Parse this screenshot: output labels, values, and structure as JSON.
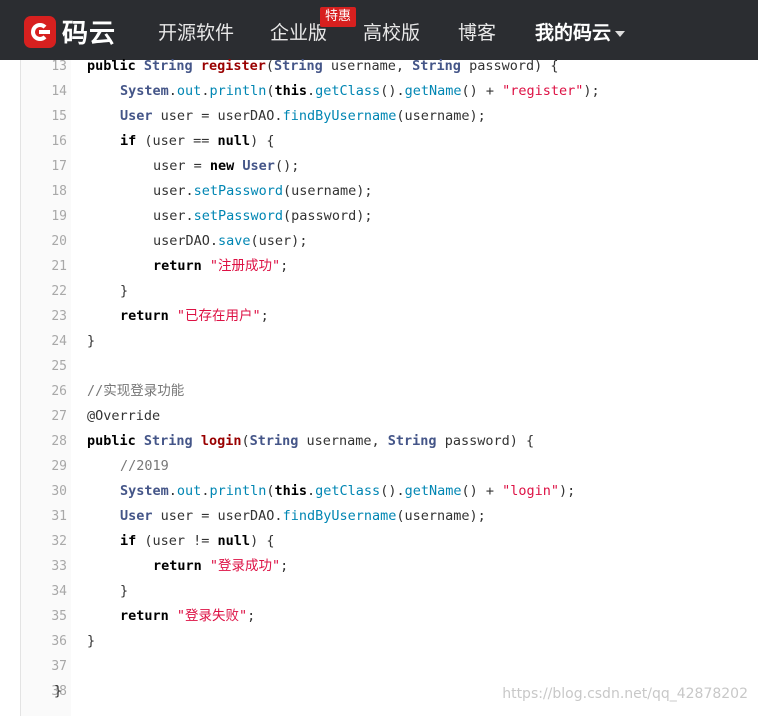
{
  "header": {
    "logo_text": "码云",
    "nav": [
      "开源软件",
      "企业版",
      "高校版",
      "博客"
    ],
    "badge": "特惠",
    "my_menu": "我的码云"
  },
  "code_lines": [
    {
      "n": "13",
      "i": 1,
      "t": [
        [
          "kw",
          "public "
        ],
        [
          "tp",
          "String "
        ],
        [
          "fn",
          "register"
        ],
        [
          "",
          "("
        ],
        [
          "tp",
          "String"
        ],
        [
          "",
          " username, "
        ],
        [
          "tp",
          "String"
        ],
        [
          "",
          " password) {"
        ]
      ]
    },
    {
      "n": "14",
      "i": 2,
      "t": [
        [
          "tp",
          "System"
        ],
        [
          "",
          "."
        ],
        [
          "mt",
          "out"
        ],
        [
          "",
          "."
        ],
        [
          "mt",
          "println"
        ],
        [
          "",
          "("
        ],
        [
          "kw",
          "this"
        ],
        [
          "",
          "."
        ],
        [
          "mt",
          "getClass"
        ],
        [
          "",
          "()."
        ],
        [
          "mt",
          "getName"
        ],
        [
          "",
          "() + "
        ],
        [
          "st",
          "\"register\""
        ],
        [
          "",
          ");"
        ]
      ]
    },
    {
      "n": "15",
      "i": 2,
      "t": [
        [
          "tp",
          "User"
        ],
        [
          "",
          " user = userDAO."
        ],
        [
          "mt",
          "findByUsername"
        ],
        [
          "",
          "(username);"
        ]
      ]
    },
    {
      "n": "16",
      "i": 2,
      "t": [
        [
          "kw",
          "if"
        ],
        [
          "",
          " (user == "
        ],
        [
          "kw",
          "null"
        ],
        [
          "",
          ") {"
        ]
      ]
    },
    {
      "n": "17",
      "i": 3,
      "t": [
        [
          "",
          "user = "
        ],
        [
          "kw",
          "new "
        ],
        [
          "tp",
          "User"
        ],
        [
          "",
          "();"
        ]
      ]
    },
    {
      "n": "18",
      "i": 3,
      "t": [
        [
          "",
          "user."
        ],
        [
          "mt",
          "setPassword"
        ],
        [
          "",
          "(username);"
        ]
      ]
    },
    {
      "n": "19",
      "i": 3,
      "t": [
        [
          "",
          "user."
        ],
        [
          "mt",
          "setPassword"
        ],
        [
          "",
          "(password);"
        ]
      ]
    },
    {
      "n": "20",
      "i": 3,
      "t": [
        [
          "",
          "userDAO."
        ],
        [
          "mt",
          "save"
        ],
        [
          "",
          "(user);"
        ]
      ]
    },
    {
      "n": "21",
      "i": 3,
      "t": [
        [
          "kw",
          "return "
        ],
        [
          "st",
          "\"注册成功\""
        ],
        [
          "",
          ";"
        ]
      ]
    },
    {
      "n": "22",
      "i": 2,
      "t": [
        [
          "",
          "}"
        ]
      ]
    },
    {
      "n": "23",
      "i": 2,
      "t": [
        [
          "kw",
          "return "
        ],
        [
          "st",
          "\"已存在用户\""
        ],
        [
          "",
          ";"
        ]
      ]
    },
    {
      "n": "24",
      "i": 1,
      "t": [
        [
          "",
          "}"
        ]
      ]
    },
    {
      "n": "25",
      "i": 0,
      "t": []
    },
    {
      "n": "26",
      "i": 1,
      "t": [
        [
          "cm",
          "//实现登录功能"
        ]
      ]
    },
    {
      "n": "27",
      "i": 1,
      "t": [
        [
          "",
          "@Override"
        ]
      ]
    },
    {
      "n": "28",
      "i": 1,
      "t": [
        [
          "kw",
          "public "
        ],
        [
          "tp",
          "String "
        ],
        [
          "fn",
          "login"
        ],
        [
          "",
          "("
        ],
        [
          "tp",
          "String"
        ],
        [
          "",
          " username, "
        ],
        [
          "tp",
          "String"
        ],
        [
          "",
          " password) {"
        ]
      ]
    },
    {
      "n": "29",
      "i": 2,
      "t": [
        [
          "cm",
          "//2019"
        ]
      ]
    },
    {
      "n": "30",
      "i": 2,
      "t": [
        [
          "tp",
          "System"
        ],
        [
          "",
          "."
        ],
        [
          "mt",
          "out"
        ],
        [
          "",
          "."
        ],
        [
          "mt",
          "println"
        ],
        [
          "",
          "("
        ],
        [
          "kw",
          "this"
        ],
        [
          "",
          "."
        ],
        [
          "mt",
          "getClass"
        ],
        [
          "",
          "()."
        ],
        [
          "mt",
          "getName"
        ],
        [
          "",
          "() + "
        ],
        [
          "st",
          "\"login\""
        ],
        [
          "",
          ");"
        ]
      ]
    },
    {
      "n": "31",
      "i": 2,
      "t": [
        [
          "tp",
          "User"
        ],
        [
          "",
          " user = userDAO."
        ],
        [
          "mt",
          "findByUsername"
        ],
        [
          "",
          "(username);"
        ]
      ]
    },
    {
      "n": "32",
      "i": 2,
      "t": [
        [
          "kw",
          "if"
        ],
        [
          "",
          " (user != "
        ],
        [
          "kw",
          "null"
        ],
        [
          "",
          ") {"
        ]
      ]
    },
    {
      "n": "33",
      "i": 3,
      "t": [
        [
          "kw",
          "return "
        ],
        [
          "st",
          "\"登录成功\""
        ],
        [
          "",
          ";"
        ]
      ]
    },
    {
      "n": "34",
      "i": 2,
      "t": [
        [
          "",
          "}"
        ]
      ]
    },
    {
      "n": "35",
      "i": 2,
      "t": [
        [
          "kw",
          "return "
        ],
        [
          "st",
          "\"登录失败\""
        ],
        [
          "",
          ";"
        ]
      ]
    },
    {
      "n": "36",
      "i": 1,
      "t": [
        [
          "",
          "}"
        ]
      ]
    },
    {
      "n": "37",
      "i": 0,
      "t": []
    },
    {
      "n": "38",
      "i": 0,
      "t": [
        [
          "",
          "}"
        ]
      ]
    }
  ],
  "watermark": "https://blog.csdn.net/qq_42878202",
  "colors": {
    "nav_bg": "#2b2d31",
    "brand_red": "#d7201f"
  }
}
